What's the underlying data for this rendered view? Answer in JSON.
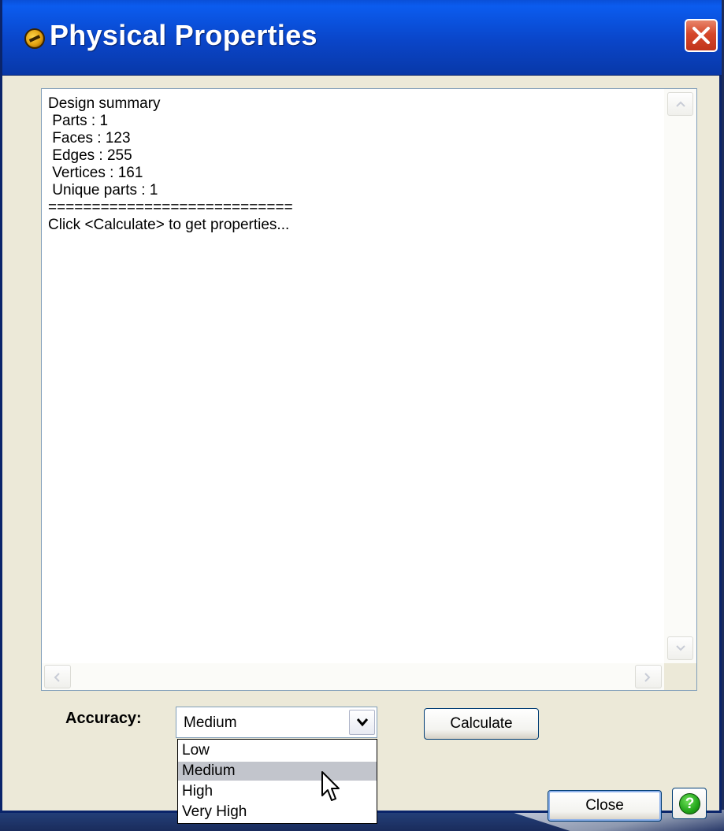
{
  "window": {
    "title": "Physical Properties",
    "close_symbol": "✕"
  },
  "output": {
    "lines": [
      "Design summary",
      " Parts : 1",
      " Faces : 123",
      " Edges : 255",
      " Vertices : 161",
      " Unique parts : 1",
      "============================",
      "Click <Calculate> to get properties..."
    ]
  },
  "controls": {
    "accuracy_label": "Accuracy:",
    "accuracy_value": "Medium",
    "accuracy_options": [
      "Low",
      "Medium",
      "High",
      "Very High"
    ],
    "highlighted_option": "Medium",
    "calculate_label": "Calculate",
    "close_label": "Close",
    "help_symbol": "?"
  },
  "icons": {
    "title": "app-logo-icon",
    "close": "close-icon",
    "dropdown": "chevron-down-icon",
    "help": "help-icon",
    "scroll_up": "scroll-up-icon",
    "scroll_down": "scroll-down-icon",
    "scroll_left": "scroll-left-icon",
    "scroll_right": "scroll-right-icon",
    "pointer": "mouse-pointer-icon"
  },
  "colors": {
    "titlebar": "#0a45c8",
    "window_bg": "#ece9d8",
    "close_button": "#d5472a",
    "selected_option": "#c2c5cc",
    "help_green": "#22a51a"
  }
}
